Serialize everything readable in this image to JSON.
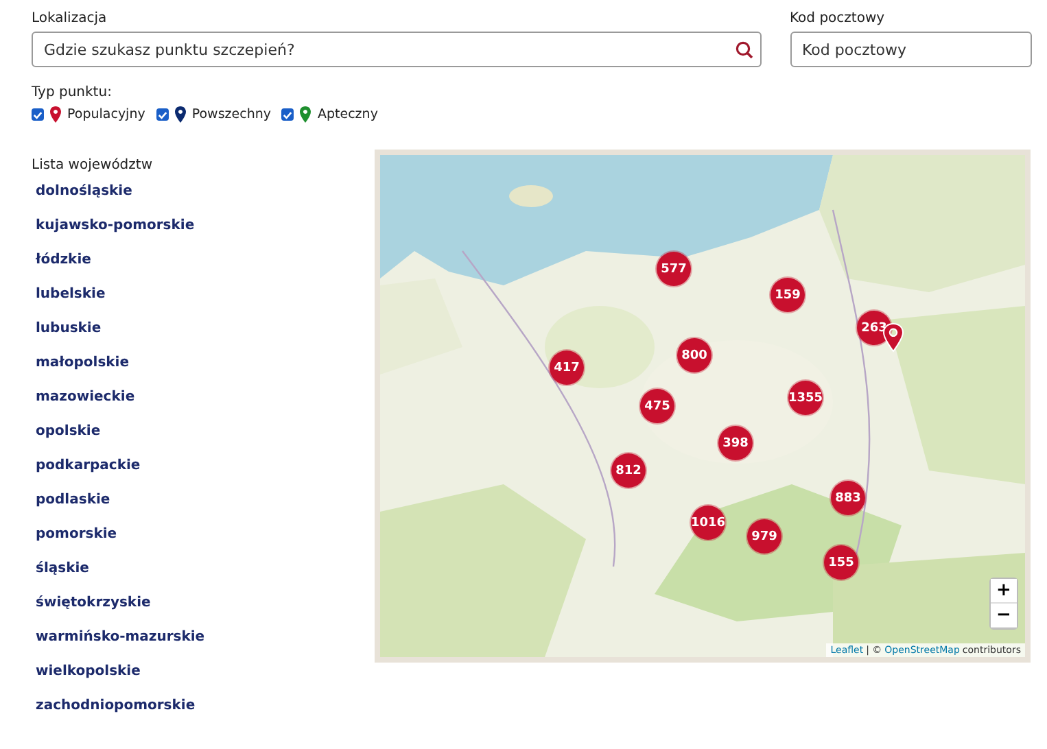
{
  "location": {
    "label": "Lokalizacja",
    "placeholder": "Gdzie szukasz punktu szczepień?"
  },
  "postal": {
    "label": "Kod pocztowy",
    "placeholder": "Kod pocztowy"
  },
  "point_types": {
    "label": "Typ punktu:",
    "items": [
      {
        "label": "Populacyjny",
        "checked": true,
        "color": "#c8102e"
      },
      {
        "label": "Powszechny",
        "checked": true,
        "color": "#0b2a6f"
      },
      {
        "label": "Apteczny",
        "checked": true,
        "color": "#1e8f2e"
      }
    ]
  },
  "voivodeships": {
    "title": "Lista województw",
    "items": [
      "dolnośląskie",
      "kujawsko-pomorskie",
      "łódzkie",
      "lubelskie",
      "lubuskie",
      "małopolskie",
      "mazowieckie",
      "opolskie",
      "podkarpackie",
      "podlaskie",
      "pomorskie",
      "śląskie",
      "świętokrzyskie",
      "warmińsko-mazurskie",
      "wielkopolskie",
      "zachodniopomorskie"
    ]
  },
  "map": {
    "kind": "picture",
    "clusters": [
      "577",
      "159",
      "263",
      "417",
      "800",
      "475",
      "1355",
      "398",
      "812",
      "883",
      "1016",
      "979",
      "155"
    ],
    "zoom_in": "+",
    "zoom_out": "−",
    "attribution": {
      "link1": "Leaflet",
      "separator": "| ©",
      "link2": "OpenStreetMap",
      "suffix": "contributors"
    }
  }
}
